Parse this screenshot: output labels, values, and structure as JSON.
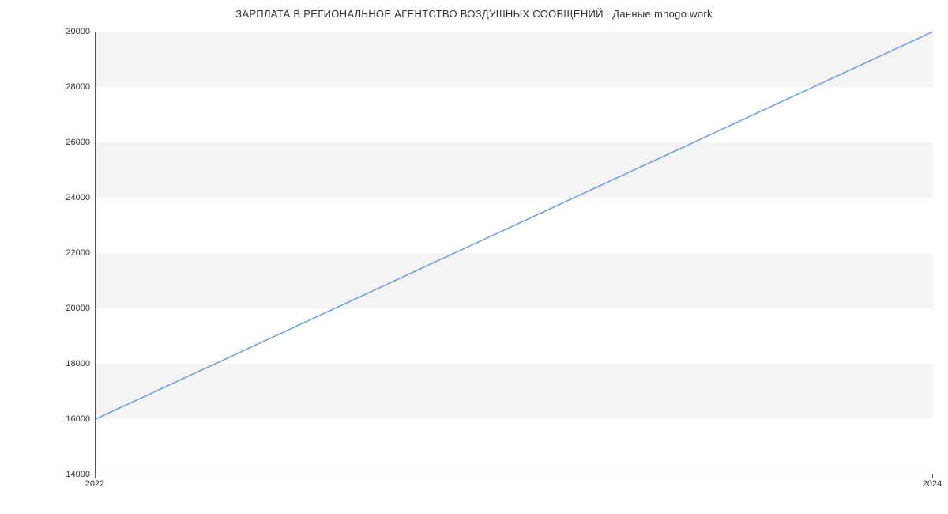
{
  "chart_data": {
    "type": "line",
    "title": "ЗАРПЛАТА В  РЕГИОНАЛЬНОЕ АГЕНТСТВО ВОЗДУШНЫХ СООБЩЕНИЙ | Данные mnogo.work",
    "x": [
      2022,
      2024
    ],
    "values": [
      16000,
      30000
    ],
    "x_ticks": [
      2022,
      2024
    ],
    "y_ticks": [
      14000,
      16000,
      18000,
      20000,
      22000,
      24000,
      26000,
      28000,
      30000
    ],
    "xlim": [
      2022,
      2024
    ],
    "ylim": [
      14000,
      30000
    ],
    "line_color": "#6a9ae0",
    "band_color": "#f4f4f4"
  }
}
